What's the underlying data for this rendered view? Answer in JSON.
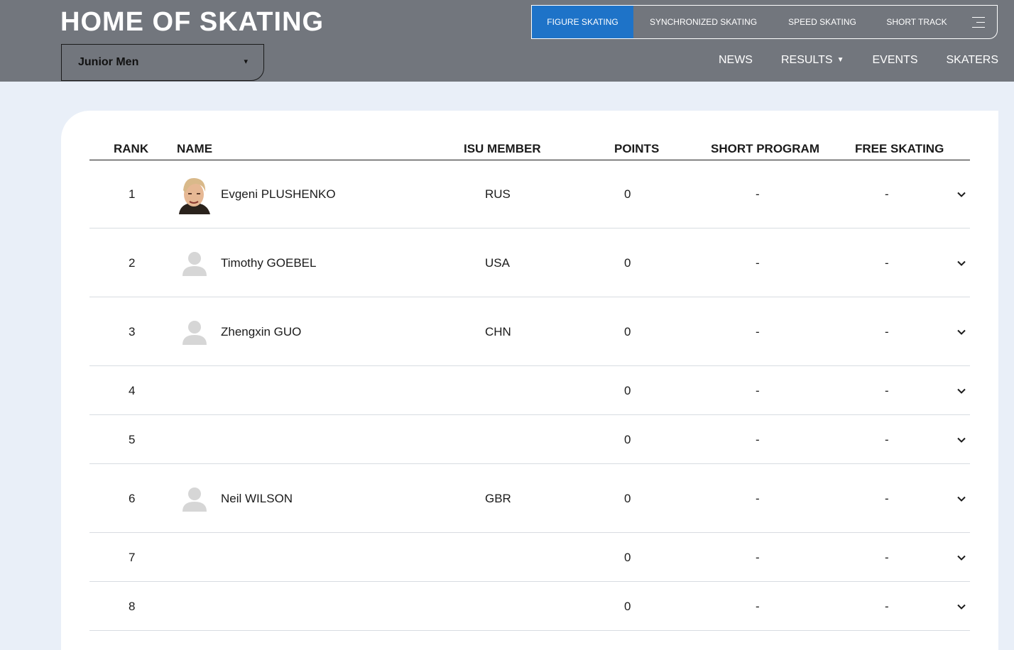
{
  "header": {
    "logo": "HOME OF SKATING",
    "category_select": {
      "value": "Junior Men",
      "caret": "▾"
    },
    "disciplines": [
      {
        "label": "FIGURE SKATING",
        "active": true
      },
      {
        "label": "SYNCHRONIZED SKATING",
        "active": false
      },
      {
        "label": "SPEED SKATING",
        "active": false
      },
      {
        "label": "SHORT TRACK",
        "active": false
      }
    ],
    "menu_icon": "hamburger-menu-icon",
    "nav": [
      {
        "label": "NEWS"
      },
      {
        "label": "RESULTS",
        "dropdown": true,
        "caret": "▼"
      },
      {
        "label": "EVENTS"
      },
      {
        "label": "SKATERS"
      }
    ]
  },
  "table": {
    "columns": {
      "rank": "RANK",
      "name": "NAME",
      "isu_member": "ISU MEMBER",
      "points": "POINTS",
      "short_program": "SHORT PROGRAM",
      "free_skating": "FREE SKATING"
    },
    "rows": [
      {
        "rank": "1",
        "name": "Evgeni PLUSHENKO",
        "isu_member": "RUS",
        "points": "0",
        "short_program": "-",
        "free_skating": "-",
        "avatar": "photo"
      },
      {
        "rank": "2",
        "name": "Timothy GOEBEL",
        "isu_member": "USA",
        "points": "0",
        "short_program": "-",
        "free_skating": "-",
        "avatar": "placeholder"
      },
      {
        "rank": "3",
        "name": "Zhengxin GUO",
        "isu_member": "CHN",
        "points": "0",
        "short_program": "-",
        "free_skating": "-",
        "avatar": "placeholder"
      },
      {
        "rank": "4",
        "name": "",
        "isu_member": "",
        "points": "0",
        "short_program": "-",
        "free_skating": "-",
        "avatar": "none"
      },
      {
        "rank": "5",
        "name": "",
        "isu_member": "",
        "points": "0",
        "short_program": "-",
        "free_skating": "-",
        "avatar": "none"
      },
      {
        "rank": "6",
        "name": "Neil WILSON",
        "isu_member": "GBR",
        "points": "0",
        "short_program": "-",
        "free_skating": "-",
        "avatar": "placeholder"
      },
      {
        "rank": "7",
        "name": "",
        "isu_member": "",
        "points": "0",
        "short_program": "-",
        "free_skating": "-",
        "avatar": "none"
      },
      {
        "rank": "8",
        "name": "",
        "isu_member": "",
        "points": "0",
        "short_program": "-",
        "free_skating": "-",
        "avatar": "none"
      }
    ]
  },
  "colors": {
    "header_bg": "#72767d",
    "accent": "#1e73c8",
    "page_bg": "#e9eff8"
  }
}
